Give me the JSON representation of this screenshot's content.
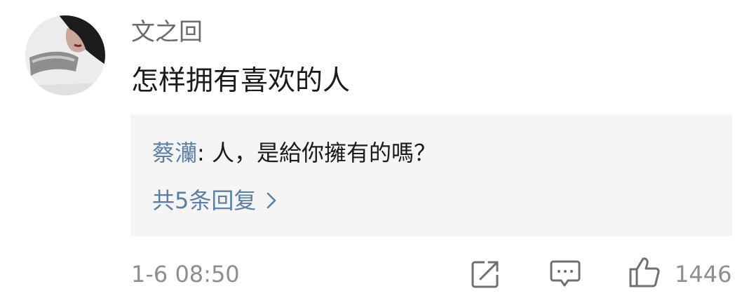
{
  "comment": {
    "username": "文之回",
    "text": "怎样拥有喜欢的人",
    "timestamp": "1-6 08:50",
    "like_count": "1446"
  },
  "reply_preview": {
    "author": "蔡灡",
    "separator": ": ",
    "text": "人，是給你擁有的嗎？",
    "more_label": "共5条回复"
  },
  "colors": {
    "link": "#5b7fa6",
    "meta": "#8e8e8e",
    "reply_bg": "#f5f5f5"
  },
  "icons": {
    "share": "share-icon",
    "comment": "comment-icon",
    "like": "thumbs-up-icon",
    "more": "chevron-right-icon"
  }
}
